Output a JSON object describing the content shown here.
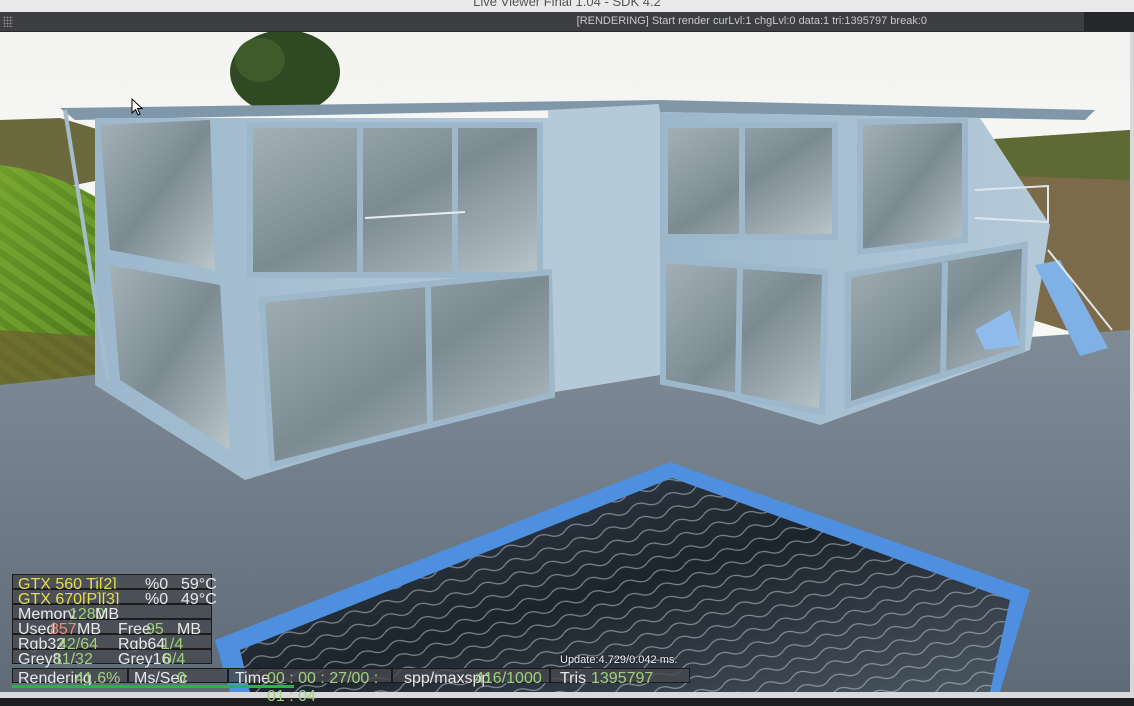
{
  "window": {
    "title": "Live Viewer Final 1.04 - SDK 4.2"
  },
  "status_message": "[RENDERING] Start render curLvl:1 chgLvl:0 data:1 tri:1395797 break:0",
  "gpus": [
    {
      "name": "GTX 560 Ti[2]",
      "load": "%0",
      "temp": "59°C"
    },
    {
      "name": "GTX 670[P][3]",
      "load": "%0",
      "temp": "49°C"
    }
  ],
  "memory": {
    "label": "Memory",
    "value": "1280",
    "unit": "MB"
  },
  "used": {
    "label": "Used",
    "value": "857",
    "unit": "MB"
  },
  "free": {
    "label": "Free",
    "value": "95",
    "unit": "MB"
  },
  "rgb32": {
    "label": "Rgb32",
    "value": "42/64"
  },
  "rgb64": {
    "label": "Rgb64",
    "value": "1/4"
  },
  "grey8": {
    "label": "Grey8",
    "value": "11/32"
  },
  "grey16": {
    "label": "Grey16",
    "value": "0/4"
  },
  "update_text": "Update:4.729/0.042 ms.",
  "bottom": {
    "rendering_label": "Rendering",
    "rendering_value": "41.6%",
    "ms_label": "Ms/Sec",
    "ms_value": "0",
    "time_label": "Time",
    "time_value": "00 : 00 : 27/00 : 01 : 04",
    "spp_label": "spp/maxspp",
    "spp_value": "416/1000",
    "tris_label": "Tris",
    "tris_value": "1395797"
  },
  "render_progress": 0.416,
  "colors": {
    "accent_green": "#2fb04c",
    "gpu_yellow": "#e9dd4f",
    "value_green": "#9fd27c",
    "value_red": "#ec8b7b"
  }
}
